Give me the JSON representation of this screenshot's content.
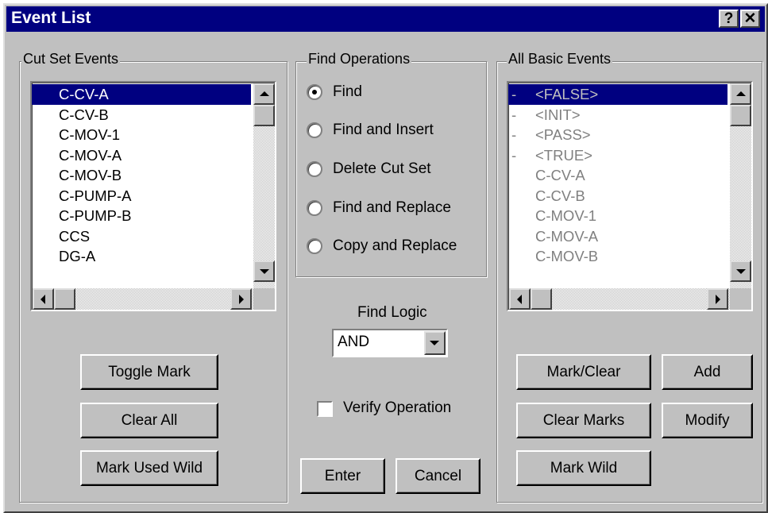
{
  "window": {
    "title": "Event List",
    "help_button": "?",
    "close_button": "✕"
  },
  "cut_set": {
    "group_label": "Cut Set Events",
    "items": [
      "C-CV-A",
      "C-CV-B",
      "C-MOV-1",
      "C-MOV-A",
      "C-MOV-B",
      "C-PUMP-A",
      "C-PUMP-B",
      "CCS",
      "DG-A"
    ],
    "selected": "C-CV-A",
    "buttons": {
      "toggle_mark": "Toggle Mark",
      "clear_all": "Clear All",
      "mark_used_wild": "Mark Used Wild"
    }
  },
  "find_operations": {
    "group_label": "Find Operations",
    "options": [
      "Find",
      "Find and Insert",
      "Delete Cut Set",
      "Find and Replace",
      "Copy and Replace"
    ],
    "selected": "Find"
  },
  "find_logic": {
    "label": "Find Logic",
    "value": "AND"
  },
  "verify": {
    "label": "Verify Operation",
    "checked": false
  },
  "center_buttons": {
    "enter": "Enter",
    "cancel": "Cancel"
  },
  "all_basic": {
    "group_label": "All Basic Events",
    "items": [
      {
        "prefix": "-",
        "text": "<FALSE>"
      },
      {
        "prefix": "-",
        "text": "<INIT>"
      },
      {
        "prefix": "-",
        "text": "<PASS>"
      },
      {
        "prefix": "-",
        "text": "<TRUE>"
      },
      {
        "prefix": "",
        "text": "C-CV-A"
      },
      {
        "prefix": "",
        "text": "C-CV-B"
      },
      {
        "prefix": "",
        "text": "C-MOV-1"
      },
      {
        "prefix": "",
        "text": "C-MOV-A"
      },
      {
        "prefix": "",
        "text": "C-MOV-B"
      }
    ],
    "selected": "<FALSE>",
    "buttons": {
      "mark_clear": "Mark/Clear",
      "add": "Add",
      "clear_marks": "Clear Marks",
      "modify": "Modify",
      "mark_wild": "Mark Wild"
    }
  },
  "icons": {
    "radio_selected": "radio-filled",
    "scroll_up": "triangle-up",
    "scroll_down": "triangle-down",
    "scroll_left": "triangle-left",
    "scroll_right": "triangle-right"
  },
  "colors": {
    "title_bar": "#000080",
    "face": "#c0c0c0",
    "selection": "#000080"
  }
}
